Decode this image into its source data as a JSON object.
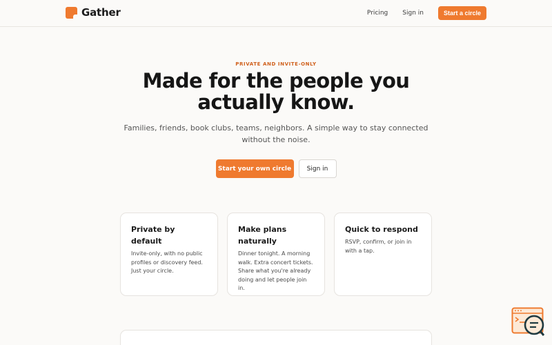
{
  "header": {
    "brand": "Gather",
    "nav": {
      "pricing": "Pricing",
      "sign_in": "Sign in",
      "cta": "Start a circle"
    }
  },
  "hero": {
    "eyebrow": "PRIVATE AND INVITE-ONLY",
    "title": "Made for the people you actually know.",
    "subtitle": "Families, friends, book clubs, teams, neighbors. A simple way to stay connected without the noise.",
    "primary_cta": "Start your own circle",
    "secondary_cta": "Sign in"
  },
  "features": [
    {
      "title": "Private by default",
      "body": "Invite-only, with no public profiles or discovery feed. Just your circle."
    },
    {
      "title": "Make plans naturally",
      "body": "Dinner tonight. A morning walk. Extra concert tickets. Share what you're already doing and let people join in."
    },
    {
      "title": "Quick to respond",
      "body": "RSVP, confirm, or join in with a tap."
    }
  ],
  "icons": {
    "brand": "logo-mark-icon",
    "chat": "chat-support-icon"
  },
  "colors": {
    "accent": "#ef7a2f",
    "eyebrow": "#d0601c",
    "background": "#fbfaf8"
  }
}
